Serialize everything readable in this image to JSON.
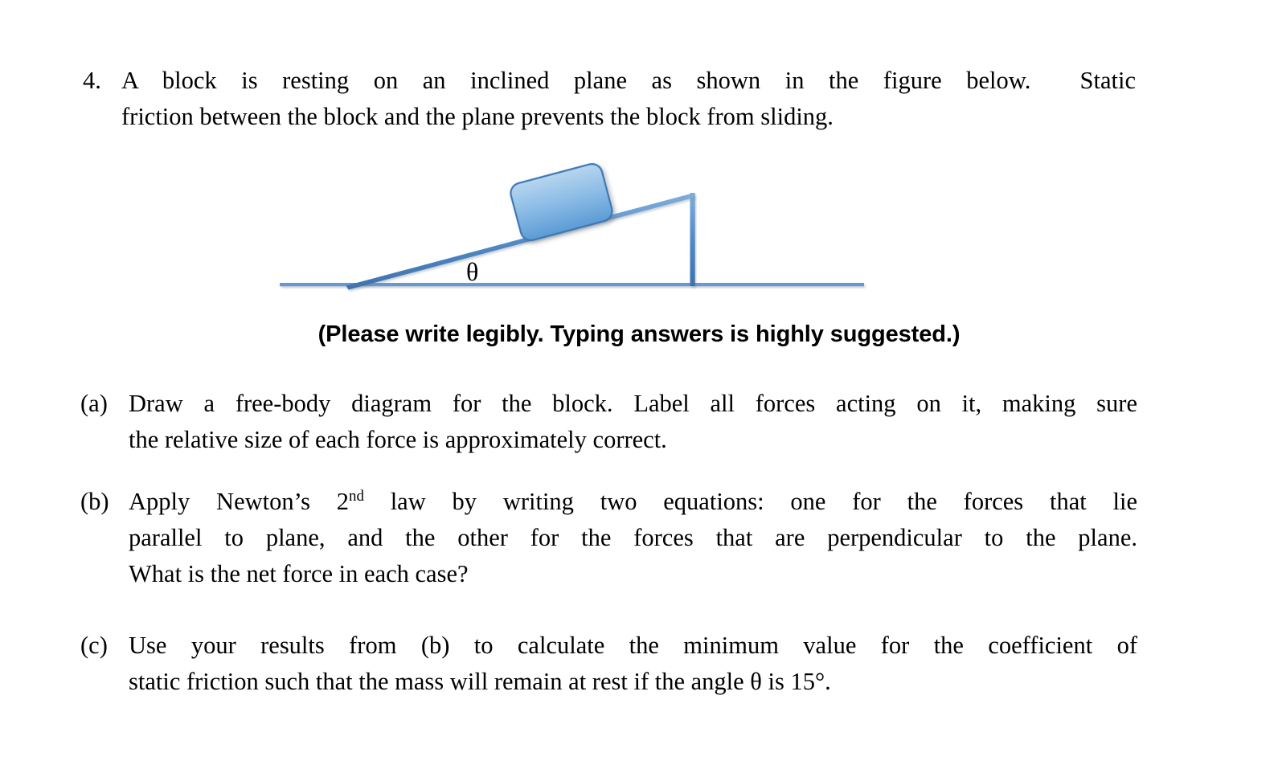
{
  "question": {
    "number": "4.",
    "stem_line1": "A block is resting on an inclined plane as shown in the figure below.",
    "stem_line1_tail": "Static",
    "stem_line2": "friction between the block and the plane prevents the block from sliding."
  },
  "figure": {
    "name": "inclined-plane-diagram",
    "angle_label": "θ",
    "line_color": "#5B9BD5",
    "line_color_dark": "#41719C",
    "block_fill_top": "#A8CCEC",
    "block_fill_bottom": "#5B9BD5",
    "block_border": "#3C78B4",
    "baseline_color": "#6699D1"
  },
  "note": "(Please write legibly. Typing answers is highly suggested.)",
  "parts": [
    {
      "tag": "(a)",
      "line1": "Draw a free-body diagram for the block. Label all forces acting on it, making sure",
      "line2": "the relative size of each force is approximately correct.",
      "line3": "",
      "line4": ""
    },
    {
      "tag": "(b)",
      "line1_pre": "Apply Newton’s 2",
      "line1_sup": "nd",
      "line1_post": " law by writing two equations: one for the forces that lie",
      "line2": "parallel to plane, and the other for the forces that are perpendicular to the plane.",
      "line3": "What is the net force in each case?"
    },
    {
      "tag": "(c)",
      "line1": "Use your results from (b) to calculate the minimum value for the coefficient of",
      "line2": "static friction such that the mass will remain at rest if the angle θ is 15°."
    }
  ]
}
